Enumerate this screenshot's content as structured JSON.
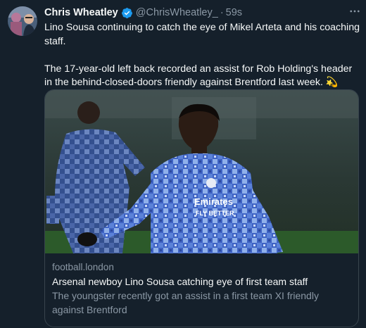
{
  "tweet": {
    "author": {
      "display_name": "Chris Wheatley",
      "handle": "@ChrisWheatley_",
      "verified_icon": "verified-badge-icon"
    },
    "separator": "·",
    "time": "59s",
    "more_icon": "more-horizontal-icon",
    "text_paragraphs": [
      "Lino Sousa continuing to catch the eye of Mikel Arteta and his coaching staff.",
      "The 17-year-old left back recorded an assist for Rob Holding's header in the behind-closed-doors friendly against Brentford last week. 💫"
    ],
    "card": {
      "domain": "football.london",
      "title": "Arsenal newboy Lino Sousa catching eye of first team staff",
      "description": "The youngster recently got an assist in a first team XI friendly against Brentford",
      "image_shirt_text": [
        "Emirates",
        "FLY BETTER"
      ]
    }
  },
  "colors": {
    "background": "#15202b",
    "text_primary": "#f7f9f9",
    "text_secondary": "#8b98a5",
    "border": "#38444d",
    "verified": "#1d9bf0"
  }
}
